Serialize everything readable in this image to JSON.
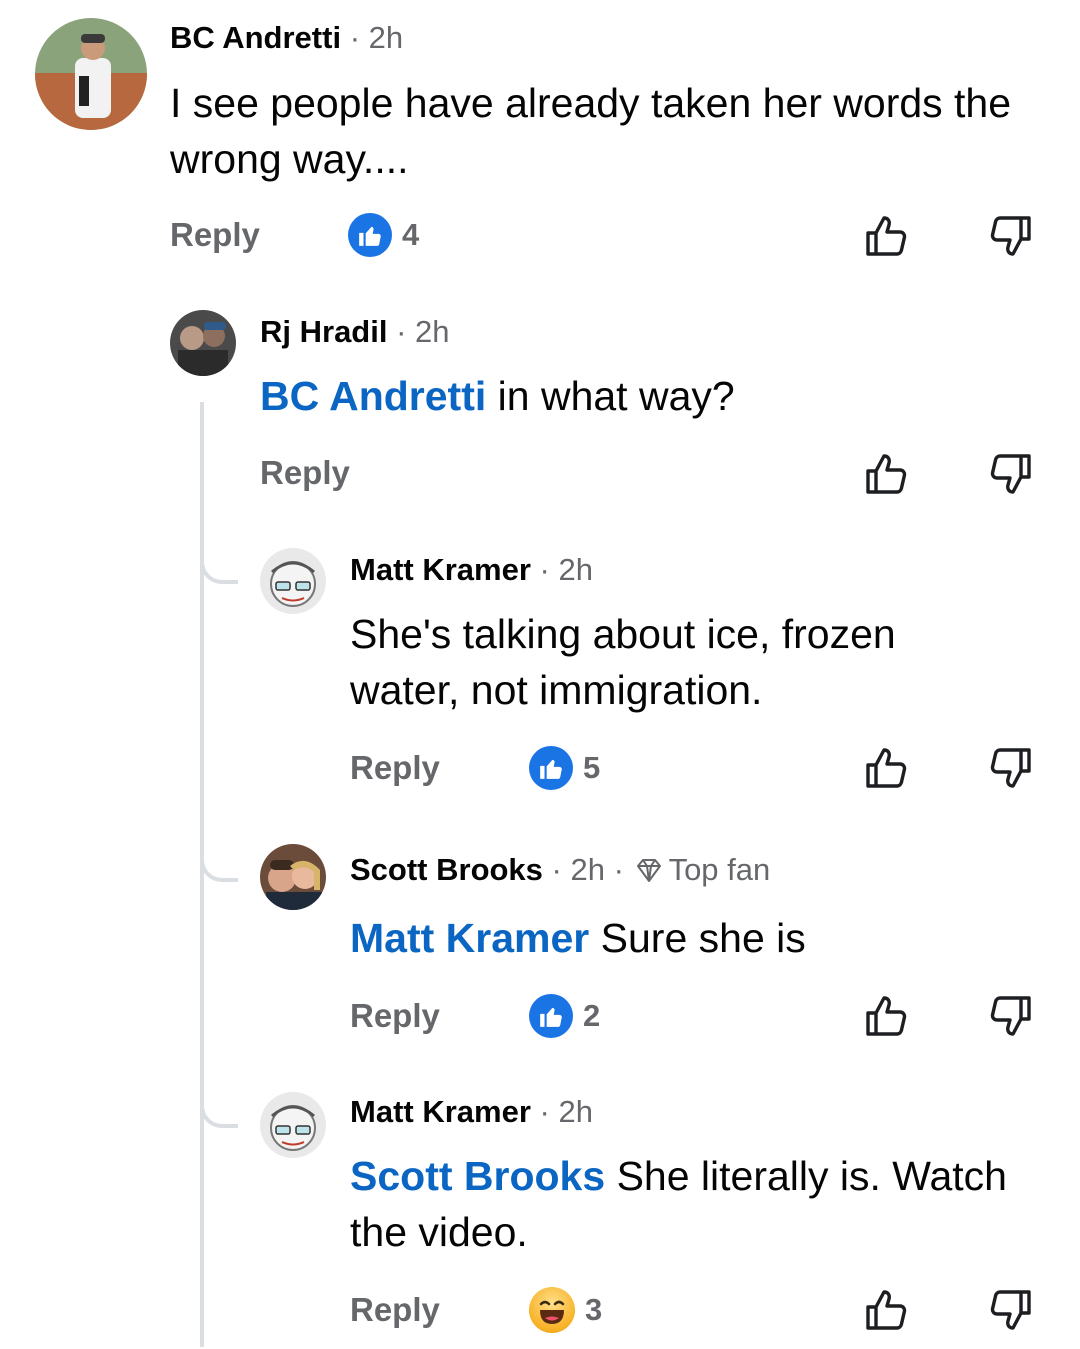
{
  "comments": [
    {
      "author": "BC Andretti",
      "time": "2h",
      "text": "I see people have already taken her words the wrong way....",
      "mention": "",
      "reply_label": "Reply",
      "reaction_count": "4",
      "reaction_type": "like"
    },
    {
      "author": "Rj Hradil",
      "time": "2h",
      "mention": "BC Andretti",
      "text": "in what way?",
      "reply_label": "Reply"
    },
    {
      "author": "Matt Kramer",
      "time": "2h",
      "mention": "",
      "text": "She's talking about ice, frozen water, not immigration.",
      "reply_label": "Reply",
      "reaction_count": "5",
      "reaction_type": "like"
    },
    {
      "author": "Scott Brooks",
      "time": "2h",
      "badge": "Top fan",
      "mention": "Matt Kramer",
      "text": "Sure she is",
      "reply_label": "Reply",
      "reaction_count": "2",
      "reaction_type": "like"
    },
    {
      "author": "Matt Kramer",
      "time": "2h",
      "mention": "Scott Brooks",
      "text": "She literally is. Watch the video.",
      "reply_label": "Reply",
      "reaction_count": "3",
      "reaction_type": "haha"
    }
  ],
  "separator": "·",
  "colors": {
    "mention": "#0a66c2",
    "like_badge": "#1b74e4",
    "meta": "#65676b",
    "thread_line": "#dadde1"
  },
  "icons": [
    "thumbs-up-icon",
    "thumbs-down-icon",
    "like-badge-icon",
    "haha-emoji-icon",
    "diamond-icon"
  ]
}
